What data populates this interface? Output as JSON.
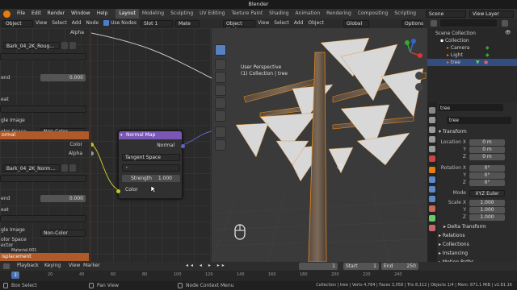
{
  "window": {
    "title": "Blender"
  },
  "topbar": {
    "menus": [
      "File",
      "Edit",
      "Render",
      "Window",
      "Help"
    ],
    "tabs": [
      "Layout",
      "Modeling",
      "Sculpting",
      "UV Editing",
      "Texture Paint",
      "Shading",
      "Animation",
      "Rendering",
      "Compositing",
      "Scripting"
    ],
    "active_tab": "Layout",
    "scene_label": "Scene",
    "view_layer_label": "View Layer"
  },
  "node_editor": {
    "header": {
      "object_mode": "Object",
      "menus": [
        "View",
        "Select",
        "Add",
        "Node"
      ],
      "use_nodes_label": "Use Nodes",
      "slot": "Slot 1",
      "material": "Mate"
    },
    "left_panel": {
      "alpha_label": "Alpha",
      "image1": "Bark_04_2K_Roug...",
      "rows1": [
        "end",
        "eat",
        "gle Image",
        "olor Space"
      ],
      "value1": "0.000",
      "colorspace1": "Non-Color",
      "normal_label": "ormal",
      "color_label": "Color",
      "alpha2_label": "Alpha",
      "image2": "Bark_04_2K_Norm...",
      "rows2": [
        "end",
        "eat",
        "gle Image",
        "olor Space"
      ],
      "value2": "0.000",
      "colorspace2": "Non-Color",
      "vector_label": "ector",
      "material_footer": "Material.001",
      "displacement_label": "isplacement"
    },
    "normal_map_node": {
      "title": "Normal Map",
      "output_label": "Normal",
      "space": "Tangent Space",
      "strength_label": "Strength",
      "strength_value": "1.000",
      "color_label": "Color"
    }
  },
  "viewport": {
    "header": {
      "mode": "Object Mode",
      "menus": [
        "View",
        "Select",
        "Add",
        "Object"
      ],
      "orientation": "Global",
      "options": "Options"
    },
    "overlay_line1": "User Perspective",
    "overlay_line2": "(1) Collection | tree"
  },
  "outliner": {
    "search_placeholder": "",
    "items": [
      {
        "label": "Scene Collection"
      },
      {
        "label": "Collection"
      },
      {
        "label": "Camera"
      },
      {
        "label": "Light"
      },
      {
        "label": "tree"
      }
    ]
  },
  "properties": {
    "object_name": "tree",
    "data_name": "tree",
    "transform_title": "Transform",
    "location_labels": [
      "Location X",
      "Y",
      "Z"
    ],
    "location_values": [
      "0 m",
      "0 m",
      "0 m"
    ],
    "rotation_labels": [
      "Rotation X",
      "Y",
      "Z"
    ],
    "rotation_values": [
      "0°",
      "0°",
      "0°"
    ],
    "mode_label": "Mode",
    "mode_value": "XYZ Euler",
    "scale_labels": [
      "Scale X",
      "Y",
      "Z"
    ],
    "scale_values": [
      "1.000",
      "1.000",
      "1.000"
    ],
    "sections": [
      "Delta Transform",
      "Relations",
      "Collections",
      "Instancing",
      "Motion Paths",
      "Visibility"
    ]
  },
  "timeline": {
    "menus": [
      "Playback",
      "Keying",
      "View",
      "Marker"
    ],
    "current_frame": "1",
    "start_label": "Start",
    "start_value": "1",
    "end_label": "End",
    "end_value": "250",
    "ticks": [
      "0",
      "20",
      "40",
      "60",
      "80",
      "100",
      "120",
      "140",
      "160",
      "180",
      "200",
      "220",
      "240"
    ]
  },
  "statusbar": {
    "hint1": "Box Select",
    "hint2": "Pan View",
    "hint3": "Node Context Menu",
    "stats": "Collection | tree | Verts 4,764 | Faces 3,058 | Tris 8,112 | Objects 1/4 | Mem: 871.1 MiB | v2.81.16"
  },
  "colors": {
    "accent": "#5680c2",
    "orange": "#e87d0d",
    "node_purple": "#7a57b4",
    "node_red": "#b05a29"
  }
}
